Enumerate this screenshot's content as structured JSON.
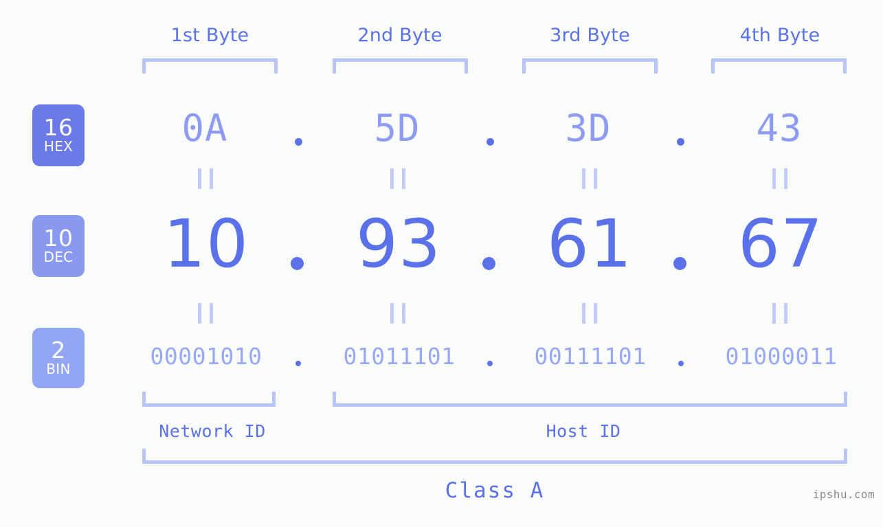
{
  "diagram": {
    "byte_headers": [
      "1st Byte",
      "2nd Byte",
      "3rd Byte",
      "4th Byte"
    ],
    "separator": ".",
    "equals_mark": "‖",
    "rows": [
      {
        "radix_number": "16",
        "radix_name": "HEX",
        "badge_color": "#6b7ae8",
        "values": [
          "0A",
          "5D",
          "3D",
          "43"
        ]
      },
      {
        "radix_number": "10",
        "radix_name": "DEC",
        "badge_color": "#8a99f0",
        "values": [
          "10",
          "93",
          "61",
          "67"
        ]
      },
      {
        "radix_number": "2",
        "radix_name": "BIN",
        "badge_color": "#93a6f5",
        "values": [
          "00001010",
          "01011101",
          "00111101",
          "01000011"
        ]
      }
    ],
    "network_id_label": "Network ID",
    "host_id_label": "Host ID",
    "class_label": "Class A",
    "watermark": "ipshu.com",
    "colors": {
      "background": "#fbfdfa",
      "accent": "#5b71ea",
      "bracket": "#b9c4f8",
      "hex_text": "#8d9cf2",
      "bin_text": "#99a8f4"
    }
  }
}
